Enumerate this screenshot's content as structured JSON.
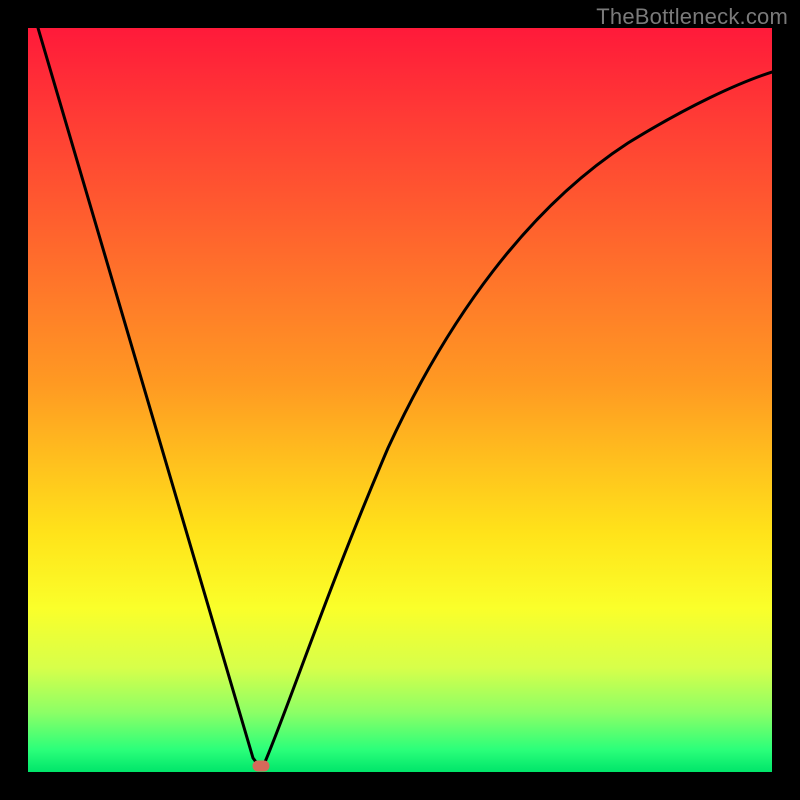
{
  "watermark": "TheBottleneck.com",
  "chart_data": {
    "type": "line",
    "title": "",
    "xlabel": "",
    "ylabel": "",
    "xlim": [
      0,
      100
    ],
    "ylim": [
      0,
      100
    ],
    "grid": false,
    "legend": false,
    "background": "red-yellow-green vertical gradient",
    "series": [
      {
        "name": "bottleneck-curve",
        "color": "#000000",
        "x": [
          0,
          4,
          8,
          12,
          16,
          20,
          24,
          28,
          30,
          31,
          32,
          34,
          36,
          40,
          45,
          50,
          55,
          60,
          65,
          70,
          75,
          80,
          85,
          90,
          95,
          100
        ],
        "y": [
          100,
          87,
          74,
          61,
          48,
          35,
          22,
          9,
          3,
          0,
          2,
          9,
          17,
          30,
          43,
          53,
          61,
          67,
          72,
          76,
          79,
          82,
          84,
          86,
          87,
          88
        ]
      }
    ],
    "markers": [
      {
        "name": "min-point",
        "x": 31,
        "y": 0,
        "shape": "rounded-rect",
        "color": "#d46a5a"
      }
    ]
  }
}
